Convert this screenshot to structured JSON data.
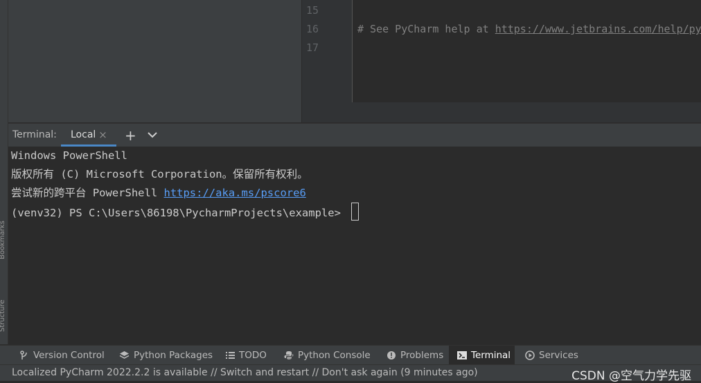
{
  "side_bar": {
    "bookmarks_label": "Bookmarks",
    "structure_label": "Structure"
  },
  "editor": {
    "line_numbers": [
      "15",
      "16",
      "17"
    ],
    "comment_prefix": "# See PyCharm help at ",
    "comment_link": "https://www.jetbrains.com/help/pycharm/"
  },
  "terminal": {
    "title": "Terminal:",
    "tab_label": "Local",
    "tab_close": "×",
    "add_tab": "+",
    "lines": {
      "line1": "Windows PowerShell",
      "line2": "版权所有 (C) Microsoft Corporation。保留所有权利。",
      "line3_prefix": "尝试新的跨平台 PowerShell ",
      "line3_link": "https://aka.ms/pscore6",
      "prompt": "(venv32) PS C:\\Users\\86198\\PycharmProjects\\example> "
    }
  },
  "tool_windows": [
    {
      "label": "Version Control",
      "icon": "branch-icon"
    },
    {
      "label": "Python Packages",
      "icon": "layers-icon"
    },
    {
      "label": "TODO",
      "icon": "list-icon"
    },
    {
      "label": "Python Console",
      "icon": "python-icon"
    },
    {
      "label": "Problems",
      "icon": "warning-icon"
    },
    {
      "label": "Terminal",
      "icon": "terminal-icon",
      "active": true
    },
    {
      "label": "Services",
      "icon": "play-icon"
    }
  ],
  "status": {
    "message": "Localized PyCharm 2022.2.2 is available // Switch and restart // Don't ask again (9 minutes ago)",
    "watermark": "CSDN @空气力学先驱"
  },
  "colors": {
    "background": "#2b2b2b",
    "panel": "#3c3f41",
    "link": "#589df6",
    "accent": "#4a88c7"
  }
}
